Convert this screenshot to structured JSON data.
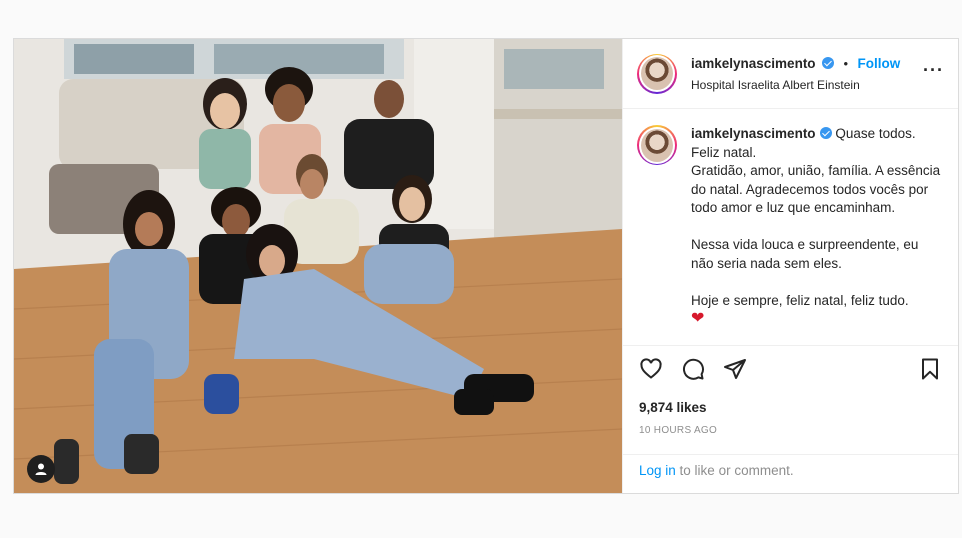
{
  "post": {
    "author": {
      "username": "iamkelynascimento",
      "verified": true,
      "follow_label": "Follow",
      "separator": "•",
      "location": "Hospital Israelita Albert Einstein"
    },
    "more_icon": "more-options-icon",
    "caption": {
      "username": "iamkelynascimento",
      "text": " Quase todos.\nFeliz natal.\nGratidão, amor, união, família. A essência do natal. Agradecemos todos vocês por todo amor e luz que encaminham.\n\nNessa vida louca e surpreendente, eu não seria nada sem eles.\n\nHoje e sempre, feliz natal, feliz tudo.",
      "emoji": "❤"
    },
    "actions": [
      "heart-icon",
      "comment-icon",
      "share-icon",
      "bookmark-icon"
    ],
    "likes": "9,874 likes",
    "timestamp": "10 HOURS AGO",
    "comment_box": {
      "login_label": "Log in",
      "rest_label": " to like or comment."
    }
  },
  "colors": {
    "follow": "#0095f6",
    "verified": "#3897f0",
    "heart": "#d7192c"
  }
}
